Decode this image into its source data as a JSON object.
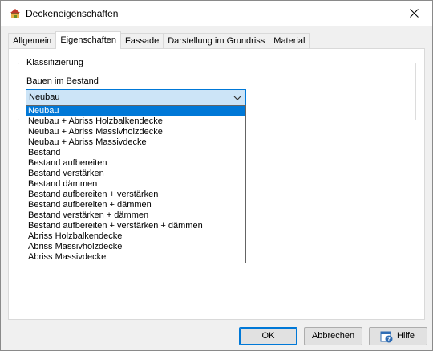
{
  "window": {
    "title": "Deckeneigenschaften",
    "icon": "app-icon",
    "close_icon": "close-icon"
  },
  "tabs": [
    {
      "label": "Allgemein",
      "active": false
    },
    {
      "label": "Eigenschaften",
      "active": true
    },
    {
      "label": "Fassade",
      "active": false
    },
    {
      "label": "Darstellung im Grundriss",
      "active": false
    },
    {
      "label": "Material",
      "active": false
    }
  ],
  "classification": {
    "group_label": "Klassifizierung",
    "field_label": "Bauen im Bestand",
    "selected_value": "Neubau",
    "options": [
      "Neubau",
      "Neubau + Abriss Holzbalkendecke",
      "Neubau + Abriss Massivholzdecke",
      "Neubau + Abriss Massivdecke",
      "Bestand",
      "Bestand aufbereiten",
      "Bestand verstärken",
      "Bestand dämmen",
      "Bestand aufbereiten + verstärken",
      "Bestand aufbereiten + dämmen",
      "Bestand verstärken + dämmen",
      "Bestand aufbereiten + verstärken + dämmen",
      "Abriss Holzbalkendecke",
      "Abriss Massivholzdecke",
      "Abriss Massivdecke"
    ]
  },
  "buttons": {
    "ok": "OK",
    "cancel": "Abbrechen",
    "help": "Hilfe"
  },
  "colors": {
    "accent": "#0078d7",
    "selection_bg": "#cce4f7"
  }
}
